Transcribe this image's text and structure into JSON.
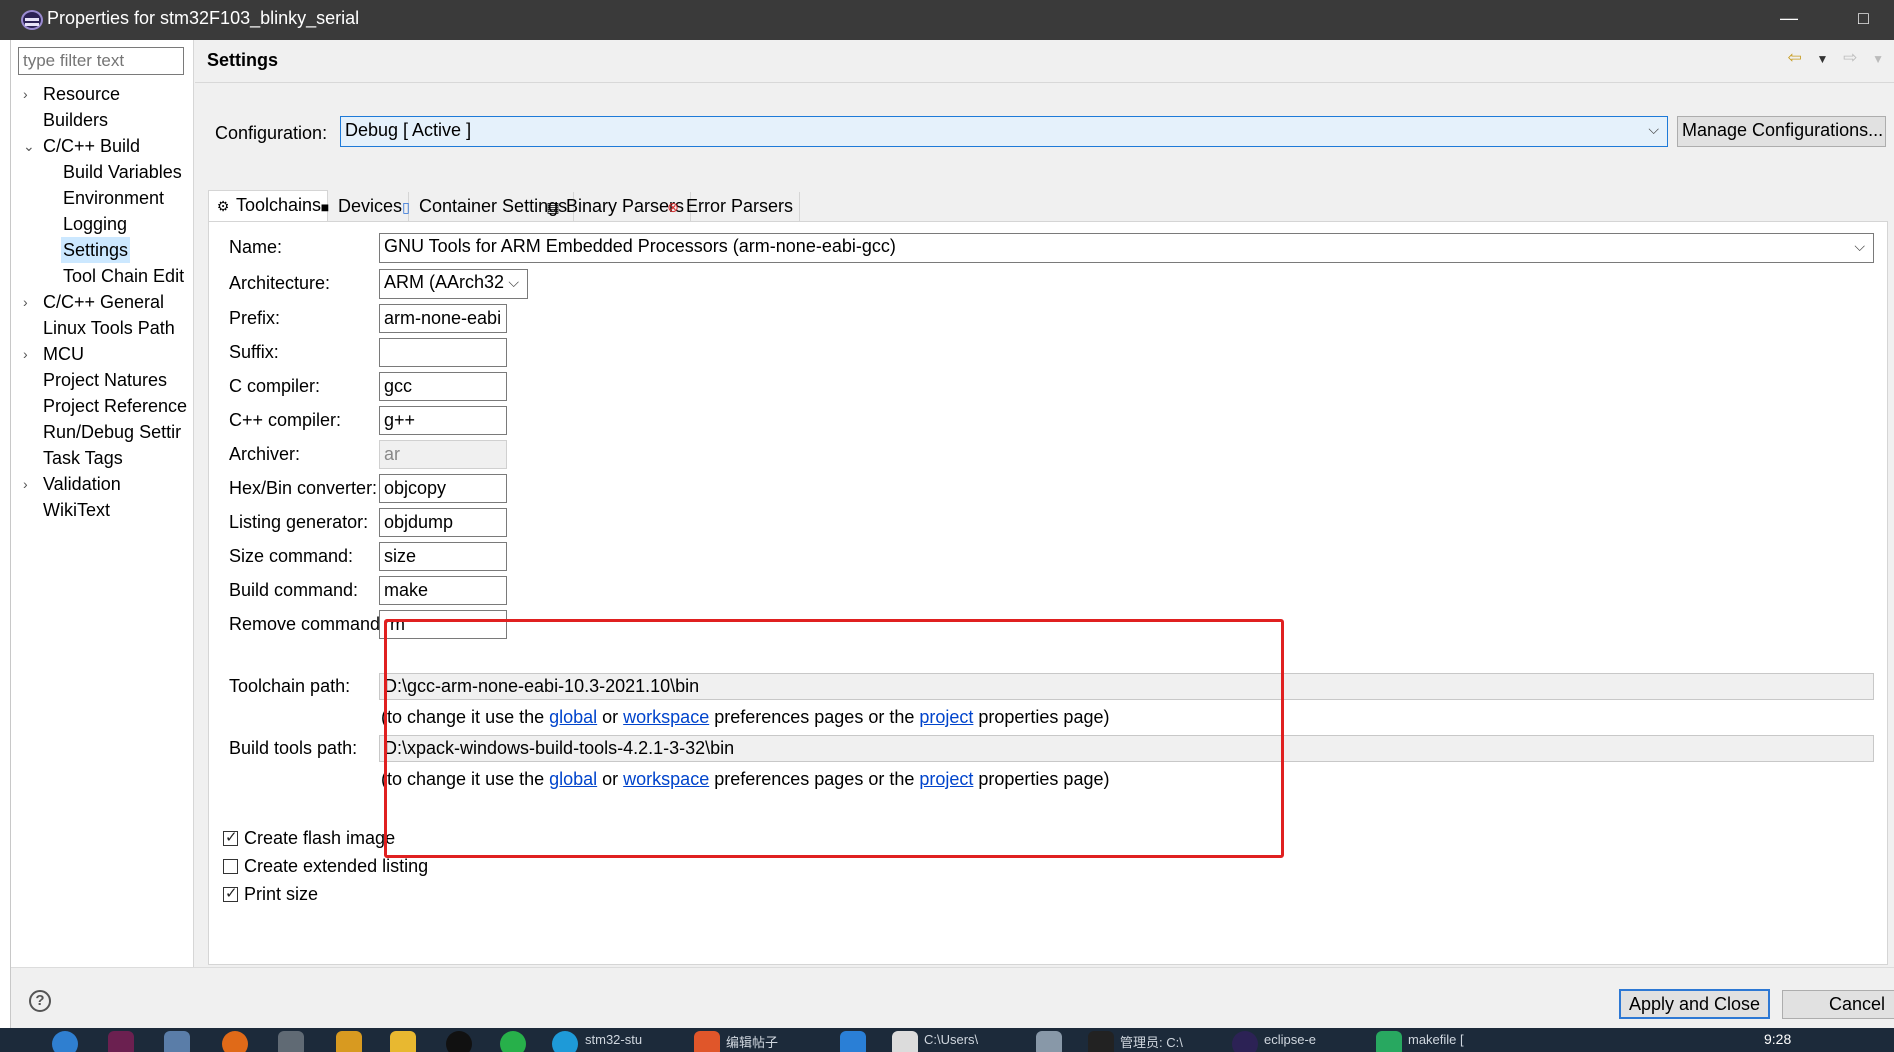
{
  "window": {
    "title": "Properties for stm32F103_blinky_serial",
    "minimize": "—",
    "maximize": "□"
  },
  "filter": {
    "placeholder": "type filter text"
  },
  "tree": [
    {
      "label": "Resource",
      "arrow": "›",
      "level": 0
    },
    {
      "label": "Builders",
      "arrow": "",
      "level": 0
    },
    {
      "label": "C/C++ Build",
      "arrow": "⌄",
      "level": 0
    },
    {
      "label": "Build Variables",
      "arrow": "",
      "level": 1
    },
    {
      "label": "Environment",
      "arrow": "",
      "level": 1
    },
    {
      "label": "Logging",
      "arrow": "",
      "level": 1
    },
    {
      "label": "Settings",
      "arrow": "",
      "level": 1,
      "selected": true
    },
    {
      "label": "Tool Chain Edit",
      "arrow": "",
      "level": 1
    },
    {
      "label": "C/C++ General",
      "arrow": "›",
      "level": 0
    },
    {
      "label": "Linux Tools Path",
      "arrow": "",
      "level": 0
    },
    {
      "label": "MCU",
      "arrow": "›",
      "level": 0
    },
    {
      "label": "Project Natures",
      "arrow": "",
      "level": 0
    },
    {
      "label": "Project Reference",
      "arrow": "",
      "level": 0
    },
    {
      "label": "Run/Debug Settir",
      "arrow": "",
      "level": 0
    },
    {
      "label": "Task Tags",
      "arrow": "",
      "level": 0
    },
    {
      "label": "Validation",
      "arrow": "›",
      "level": 0
    },
    {
      "label": "WikiText",
      "arrow": "",
      "level": 0
    }
  ],
  "page": {
    "title": "Settings"
  },
  "config": {
    "label": "Configuration:",
    "value": "Debug  [ Active ]",
    "manage_label": "Manage Configurations..."
  },
  "tabs": [
    {
      "label": "Toolchains",
      "icon": "⚙",
      "name": "tab-toolchains"
    },
    {
      "label": "Devices",
      "icon": "■",
      "name": "tab-devices"
    },
    {
      "label": "Container Settings",
      "icon": "▯",
      "name": "tab-container-settings"
    },
    {
      "label": "Binary Parsers",
      "icon": "▤",
      "name": "tab-binary-parsers"
    },
    {
      "label": "Error Parsers",
      "icon": "⊗",
      "name": "tab-error-parsers"
    }
  ],
  "fields": {
    "name_label": "Name:",
    "name_value": "GNU Tools for ARM Embedded Processors (arm-none-eabi-gcc)",
    "arch_label": "Architecture:",
    "arch_value": "ARM (AArch32",
    "prefix_label": "Prefix:",
    "prefix_value": "arm-none-eabi",
    "suffix_label": "Suffix:",
    "suffix_value": "",
    "c_label": "C compiler:",
    "c_value": "gcc",
    "cpp_label": "C++ compiler:",
    "cpp_value": "g++",
    "archiver_label": "Archiver:",
    "archiver_value": "ar",
    "hex_label": "Hex/Bin converter:",
    "hex_value": "objcopy",
    "listing_label": "Listing generator:",
    "listing_value": "objdump",
    "size_label": "Size command:",
    "size_value": "size",
    "build_label": "Build command:",
    "build_value": "make",
    "remove_label": "Remove command:",
    "remove_value": "rm",
    "toolchain_path_label": "Toolchain path:",
    "toolchain_path_value": "D:\\gcc-arm-none-eabi-10.3-2021.10\\bin",
    "build_tools_label": "Build tools path:",
    "build_tools_value": "D:\\xpack-windows-build-tools-4.2.1-3-32\\bin"
  },
  "hint": {
    "pre": "(to change it use the ",
    "global": "global",
    "or": " or ",
    "workspace": "workspace",
    "mid": " preferences pages or the ",
    "project": "project",
    "post": " properties page)"
  },
  "checks": {
    "flash": {
      "label": "Create flash image",
      "checked": true
    },
    "listing": {
      "label": "Create extended listing",
      "checked": false
    },
    "print": {
      "label": "Print size",
      "checked": true
    }
  },
  "buttons": {
    "apply": "Apply and Close",
    "cancel": "Cancel",
    "help": "?"
  },
  "taskbar": {
    "items": [
      "stm32-stu",
      "编辑帖子",
      "C:\\Users\\",
      "管理员: C:\\",
      "eclipse-e",
      "makefile ["
    ],
    "clock": "9:28"
  },
  "colors": {
    "accent": "#1e7ad8",
    "highlight": "#e02020",
    "link": "#0044cc"
  }
}
